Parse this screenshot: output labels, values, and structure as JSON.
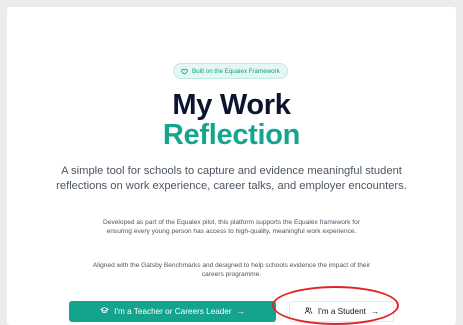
{
  "badge": {
    "label": "Built on the Equalex Framework",
    "icon": "heart-icon"
  },
  "hero": {
    "title_line1": "My Work",
    "title_line2": "Reflection",
    "lead": "A simple tool for schools to capture and evidence meaningful student reflections on work experience, career talks, and employer encounters.",
    "para1": "Developed as part of the Equalex pilot, this platform supports the Equalex framework for ensuring every young person has access to high-quality, meaningful work experience.",
    "para2": "Aligned with the Gatsby Benchmarks and designed to help schools evidence the impact of their careers programme."
  },
  "buttons": {
    "teacher": {
      "label": "I'm a Teacher or Careers Leader",
      "arrow": "→",
      "icon": "graduation-cap-icon"
    },
    "student": {
      "label": "I'm a Student",
      "arrow": "→",
      "icon": "users-icon"
    }
  },
  "colors": {
    "accent": "#13a590",
    "title_dark": "#0b1530",
    "annotation": "#e0262b"
  }
}
